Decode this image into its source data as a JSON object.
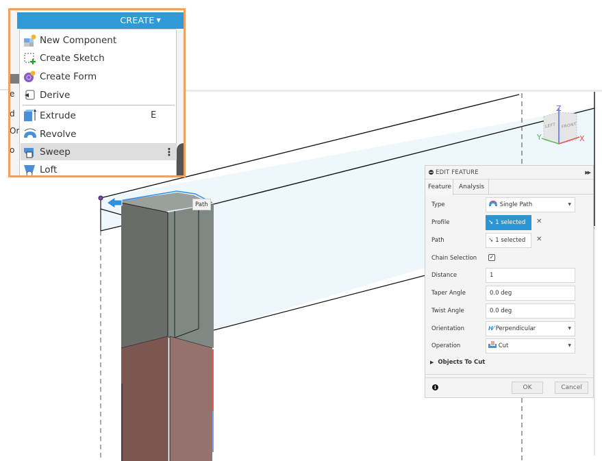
{
  "create_menu": {
    "title": "CREATE",
    "items": [
      {
        "label": "New Component",
        "icon": "new-component-icon",
        "shortcut": ""
      },
      {
        "label": "Create Sketch",
        "icon": "create-sketch-icon",
        "shortcut": ""
      },
      {
        "label": "Create Form",
        "icon": "create-form-icon",
        "shortcut": ""
      },
      {
        "label": "Derive",
        "icon": "derive-icon",
        "shortcut": ""
      },
      {
        "label": "Extrude",
        "icon": "extrude-icon",
        "shortcut": "E"
      },
      {
        "label": "Revolve",
        "icon": "revolve-icon",
        "shortcut": ""
      },
      {
        "label": "Sweep",
        "icon": "sweep-icon",
        "shortcut": "",
        "active": true,
        "more": "⋮"
      },
      {
        "label": "Loft",
        "icon": "loft-icon",
        "shortcut": ""
      }
    ],
    "side_fragments": [
      "e",
      "d",
      "Or",
      "o"
    ],
    "accent_color": "#2f9ad6",
    "highlight_color": "#f0a060"
  },
  "viewport": {
    "path_tooltip": "Path",
    "viewcube": {
      "left": "LEFT",
      "front": "FRONT",
      "x": "X",
      "y": "Y",
      "z": "Z"
    }
  },
  "edit_feature": {
    "title": "EDIT FEATURE",
    "tabs": [
      "Feature",
      "Analysis"
    ],
    "type": {
      "label": "Type",
      "value": "Single Path"
    },
    "profile": {
      "label": "Profile",
      "value": "1 selected"
    },
    "path": {
      "label": "Path",
      "value": "1 selected"
    },
    "chain_selection": {
      "label": "Chain Selection",
      "checked": true,
      "mark": "✓"
    },
    "distance": {
      "label": "Distance",
      "value": "1"
    },
    "taper_angle": {
      "label": "Taper Angle",
      "value": "0.0 deg"
    },
    "twist_angle": {
      "label": "Twist Angle",
      "value": "0.0 deg"
    },
    "orientation": {
      "label": "Orientation",
      "value": "Perpendicular"
    },
    "operation": {
      "label": "Operation",
      "value": "Cut"
    },
    "objects_to_cut": "Objects To Cut",
    "ok": "OK",
    "cancel": "Cancel",
    "selected_color": "#2c95d6"
  }
}
